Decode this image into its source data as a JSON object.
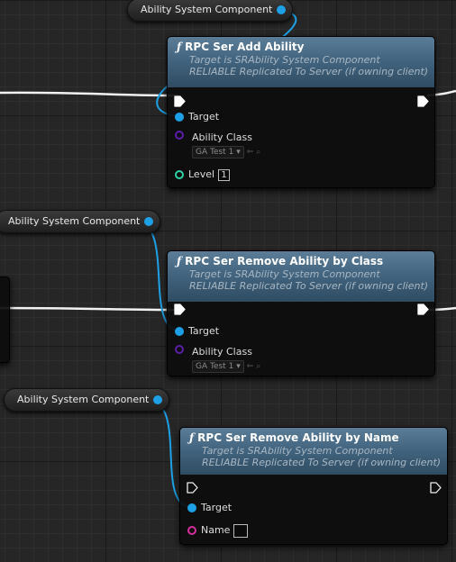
{
  "variables": [
    {
      "label": "Ability System Component"
    },
    {
      "label": "Ability System Component"
    },
    {
      "label": "Ability System Component"
    }
  ],
  "nodes": [
    {
      "icon": "ƒ",
      "title": "RPC Ser Add Ability",
      "subtitle_target": "Target is SRAbility System Component",
      "subtitle_replication": "RELIABLE Replicated To Server (if owning client)",
      "pins": {
        "target": "Target",
        "ability_class": "Ability Class",
        "ability_class_value": "GA Test 1",
        "level": "Level",
        "level_value": "1"
      }
    },
    {
      "icon": "ƒ",
      "title": "RPC Ser Remove Ability by Class",
      "subtitle_target": "Target is SRAbility System Component",
      "subtitle_replication": "RELIABLE Replicated To Server (if owning client)",
      "pins": {
        "target": "Target",
        "ability_class": "Ability Class",
        "ability_class_value": "GA Test 1"
      }
    },
    {
      "icon": "ƒ",
      "title": "RPC Ser Remove Ability by Name",
      "subtitle_target": "Target is SRAbility System Component",
      "subtitle_replication": "RELIABLE Replicated To Server (if owning client)",
      "pins": {
        "target": "Target",
        "name": "Name",
        "name_value": ""
      }
    }
  ],
  "icons": {
    "function": "function-icon",
    "exec": "exec-pin-icon",
    "dropdown": "chevron-down-icon",
    "reset": "arrow-left-icon",
    "browse": "search-icon"
  },
  "colors": {
    "object_pin": "#1ea0e6",
    "class_pin": "#5b1ea8",
    "int_pin": "#2dd3a6",
    "name_pin": "#d32e9d",
    "exec_wire": "#ffffff",
    "header": "#436580"
  }
}
